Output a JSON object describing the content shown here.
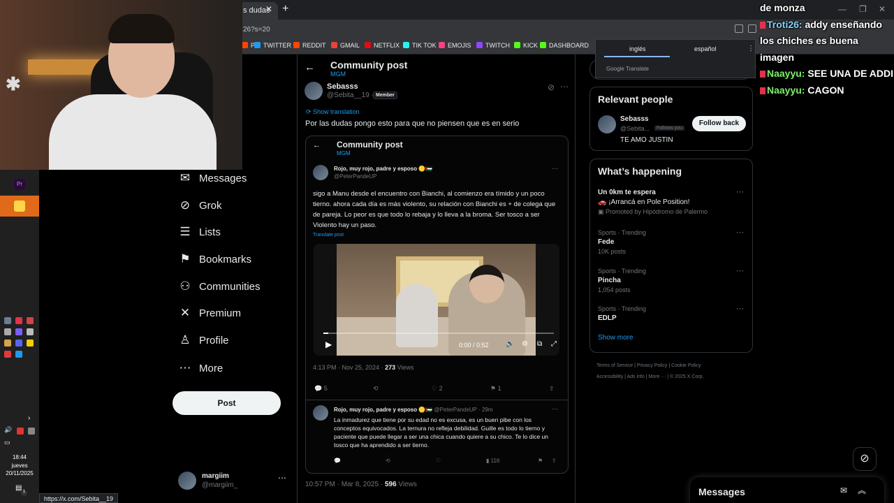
{
  "browser": {
    "tab_title": "s dudas",
    "url_fragment": "26?s=20",
    "bookmarks": [
      {
        "label": "P",
        "color": "#ff4500"
      },
      {
        "label": "TWITTER",
        "color": "#1d9bf0"
      },
      {
        "label": "REDDIT",
        "color": "#ff4500"
      },
      {
        "label": "GMAIL",
        "color": "#ea4335"
      },
      {
        "label": "NETFLIX",
        "color": "#e50914"
      },
      {
        "label": "TIK TOK",
        "color": "#25f4ee"
      },
      {
        "label": "EMOJIS",
        "color": "#ff4081"
      },
      {
        "label": "TWITCH",
        "color": "#9146ff"
      },
      {
        "label": "KICK",
        "color": "#53fc18"
      },
      {
        "label": "DASHBOARD",
        "color": "#53fc18"
      }
    ],
    "status_url": "https://x.com/Sebita__19"
  },
  "translate_popup": {
    "lang_from": "inglés",
    "lang_to": "español",
    "provider": "Google Translate"
  },
  "taskbar": {
    "time": "18:44",
    "day": "jueves",
    "date": "20/11/2025",
    "notification_count": "1"
  },
  "sidebar": {
    "partial_item": "ons",
    "items": [
      {
        "label": "Messages",
        "icon": "mail-icon",
        "glyph": "✉"
      },
      {
        "label": "Grok",
        "icon": "grok-icon",
        "glyph": "⊘"
      },
      {
        "label": "Lists",
        "icon": "lists-icon",
        "glyph": "☰"
      },
      {
        "label": "Bookmarks",
        "icon": "bookmark-icon",
        "glyph": "⚑"
      },
      {
        "label": "Communities",
        "icon": "communities-icon",
        "glyph": "⚇"
      },
      {
        "label": "Premium",
        "icon": "x-logo-icon",
        "glyph": "✕"
      },
      {
        "label": "Profile",
        "icon": "profile-icon",
        "glyph": "♙"
      },
      {
        "label": "More",
        "icon": "more-icon",
        "glyph": "⋯"
      }
    ],
    "post_button": "Post",
    "account": {
      "name": "margiim",
      "handle": "@margiim_"
    }
  },
  "main": {
    "header_title": "Community post",
    "header_sub": "MGM",
    "author": {
      "name": "Sebasss",
      "handle": "@Sebita__19 ·",
      "badge": "Member"
    },
    "show_translation": "Show translation",
    "text": "Por las dudas pongo esto para que no piensen que es en serio",
    "embedded": {
      "header_title": "Community post",
      "header_sub": "MGM",
      "author_name": "Rojo, muy rojo, padre y esposo 🟡🇵🇸",
      "author_handle": "@PeterPandeUP",
      "text": "sigo a Manu desde el encuentro con Bianchi, al comienzo era tímido y un poco tierno. ahora cada día es más violento, su relación con Bianchi es + de colega que de pareja. Lo peor es que todo lo rebaja y lo lleva a la broma. Ser tosco a ser Violento hay un paso.",
      "translate": "Translate post",
      "video_time": "0:00 / 0:52",
      "video_progress": 0.02,
      "date": "4:13 PM · Nov 25, 2024 ·",
      "views_count": "273",
      "views_label": "Views",
      "replies": "5",
      "likes": "2",
      "bookmarks": "1",
      "reply": {
        "author_name": "Rojo, muy rojo, padre y esposo 🟡🇵🇸",
        "author_handle": "@PeterPandeUP · 29m",
        "text": "La inmadurez que tiene por su edad no es excusa, es un buen pibe con los conceptos equivocados. La ternura no refleja debilidad. Guille es todo lo tierno y paciente que puede llegar a ser una chica cuando quiere a su chico. Te lo dice un tosco que ha aprendido a ser tierno.",
        "views": "116"
      }
    },
    "date": "10:57 PM · Mar 8, 2025 ·",
    "views_count": "596",
    "views_label": "Views"
  },
  "right": {
    "relevant_title": "Relevant people",
    "person": {
      "name": "Sebasss",
      "handle": "@Sebita...",
      "follows_you": "Follows you",
      "bio": "TE AMO JUSTIN",
      "button": "Follow back"
    },
    "happening_title": "What’s happening",
    "promo": {
      "title": "Un 0km te espera",
      "sub": "🚗 ¡Arrancá en Pole Position!",
      "promoted": "Promoted by Hipódromo de Palermo"
    },
    "trends": [
      {
        "meta": "Sports · Trending",
        "title": "Fede",
        "posts": "10K posts"
      },
      {
        "meta": "Sports · Trending",
        "title": "Pincha",
        "posts": "1,054 posts"
      },
      {
        "meta": "Sports · Trending",
        "title": "EDLP",
        "posts": ""
      }
    ],
    "show_more": "Show more",
    "footer_line1": [
      "Terms of Service",
      "Privacy Policy",
      "Cookie Policy"
    ],
    "footer_line2": [
      "Accessibility",
      "Ads info",
      "More ···",
      "© 2025 X Corp."
    ]
  },
  "messages_drawer": {
    "title": "Messages"
  },
  "chat": [
    {
      "user": "",
      "text": "de monza",
      "user_color": "cyan"
    },
    {
      "user": "Troti26:",
      "text": "addy enseñando los chiches es buena imagen",
      "user_color": "cyan"
    },
    {
      "user": "Naayyu:",
      "text": "SEE UNA DE ADDI",
      "user_color": "green"
    },
    {
      "user": "Naayyu:",
      "text": "CAGON",
      "user_color": "green"
    }
  ]
}
